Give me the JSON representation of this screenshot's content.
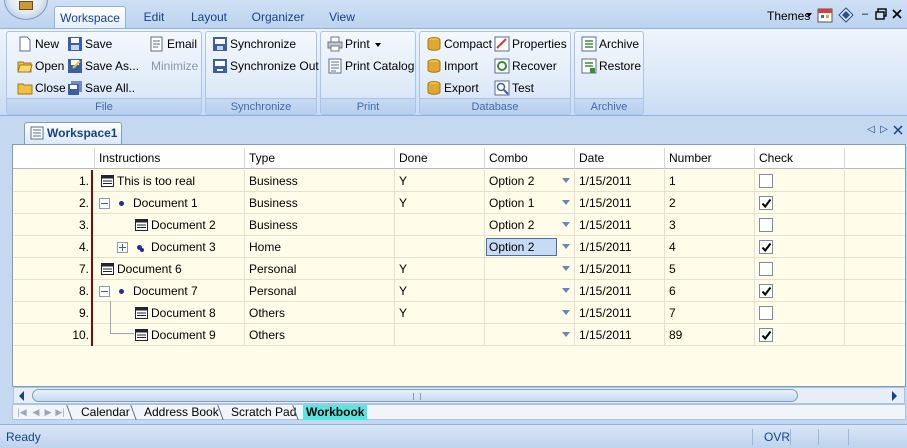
{
  "ribbon_tabs": [
    "Workspace",
    "Edit",
    "Layout",
    "Organizer",
    "View"
  ],
  "active_tab": "Workspace",
  "themes_label": "Themes",
  "groups": {
    "file": {
      "label": "File",
      "buttons": {
        "new": "New",
        "save": "Save",
        "email": "Email",
        "open": "Open",
        "save_as": "Save As...",
        "minimize": "Minimize",
        "close": "Close",
        "save_all": "Save All.."
      }
    },
    "synchronize": {
      "label": "Synchronize",
      "buttons": {
        "synchronize": "Synchronize",
        "synchronize_out": "Synchronize Out"
      }
    },
    "print": {
      "label": "Print",
      "buttons": {
        "print": "Print",
        "print_catalog": "Print Catalog"
      }
    },
    "database": {
      "label": "Database",
      "buttons": {
        "compact": "Compact",
        "properties": "Properties",
        "import": "Import",
        "recover": "Recover",
        "export": "Export",
        "test": "Test"
      }
    },
    "archive": {
      "label": "Archive",
      "buttons": {
        "archive": "Archive",
        "restore": "Restore"
      }
    }
  },
  "document_tab": "Workspace1",
  "columns": [
    "Instructions",
    "Type",
    "Done",
    "Combo",
    "Date",
    "Number",
    "Check"
  ],
  "rows": [
    {
      "num": "1.",
      "instruction": "This is too real",
      "type": "Business",
      "done": "Y",
      "combo": "Option 2",
      "date": "1/15/2011",
      "number": "1",
      "checked": false
    },
    {
      "num": "2.",
      "instruction": "Document 1",
      "type": "Business",
      "done": "Y",
      "combo": "Option 1",
      "date": "1/15/2011",
      "number": "2",
      "checked": true
    },
    {
      "num": "3.",
      "instruction": "Document 2",
      "type": "Business",
      "done": "",
      "combo": "Option 2",
      "date": "1/15/2011",
      "number": "3",
      "checked": false
    },
    {
      "num": "4.",
      "instruction": "Document 3",
      "type": "Home",
      "done": "",
      "combo": "Option 2",
      "date": "1/15/2011",
      "number": "4",
      "checked": true
    },
    {
      "num": "7.",
      "instruction": "Document 6",
      "type": "Personal",
      "done": "Y",
      "combo": "",
      "date": "1/15/2011",
      "number": "5",
      "checked": false
    },
    {
      "num": "8.",
      "instruction": "Document 7",
      "type": "Personal",
      "done": "Y",
      "combo": "",
      "date": "1/15/2011",
      "number": "6",
      "checked": true
    },
    {
      "num": "9.",
      "instruction": "Document 8",
      "type": "Others",
      "done": "Y",
      "combo": "",
      "date": "1/15/2011",
      "number": "7",
      "checked": false
    },
    {
      "num": "10.",
      "instruction": "Document 9",
      "type": "Others",
      "done": "",
      "combo": "",
      "date": "1/15/2011",
      "number": "89",
      "checked": true
    }
  ],
  "sheet_tabs": [
    "Calendar",
    "Address Book",
    "Scratch Pad",
    "Workbook"
  ],
  "active_sheet": "Workbook",
  "status": {
    "left": "Ready",
    "mode": "OVR"
  },
  "colors": {
    "accent": "#15428b",
    "grid_bg": "#fffde9",
    "active_sheet": "#56e8e0",
    "row_marker": "#7a0e0e"
  }
}
